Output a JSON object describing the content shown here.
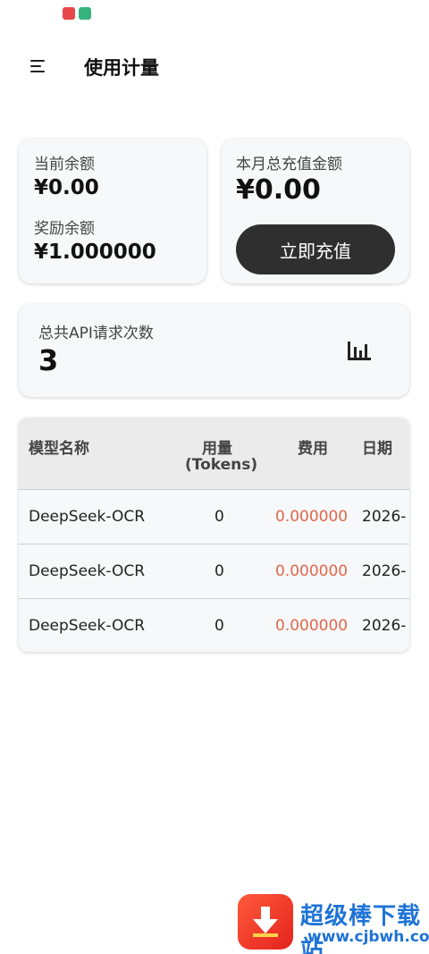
{
  "header": {
    "title": "使用计量"
  },
  "balance_card": {
    "current_label": "当前余额",
    "current_value": "¥0.00",
    "reward_label": "奖励余额",
    "reward_value": "¥1.000000"
  },
  "recharge_card": {
    "label": "本月总充值金额",
    "value": "¥0.00",
    "button_label": "立即充值"
  },
  "requests_card": {
    "label": "总共API请求次数",
    "value": "3",
    "icon": "bar-chart-icon"
  },
  "usage_table": {
    "columns": [
      "模型名称",
      "用量",
      "(Tokens)",
      "费用",
      "日期"
    ],
    "rows": [
      {
        "model": "DeepSeek-OCR",
        "tokens": "0",
        "cost": "0.000000",
        "date": "2026-"
      },
      {
        "model": "DeepSeek-OCR",
        "tokens": "0",
        "cost": "0.000000",
        "date": "2026-"
      },
      {
        "model": "DeepSeek-OCR",
        "tokens": "0",
        "cost": "0.000000",
        "date": "2026-"
      }
    ]
  },
  "watermark": {
    "title": "超级棒下载站",
    "url": "www.cjbwh.com"
  },
  "colors": {
    "cost": "#e0674c",
    "button": "#2f2f2f",
    "card": "#f7f8f9",
    "watermark": "#1e73d6"
  }
}
